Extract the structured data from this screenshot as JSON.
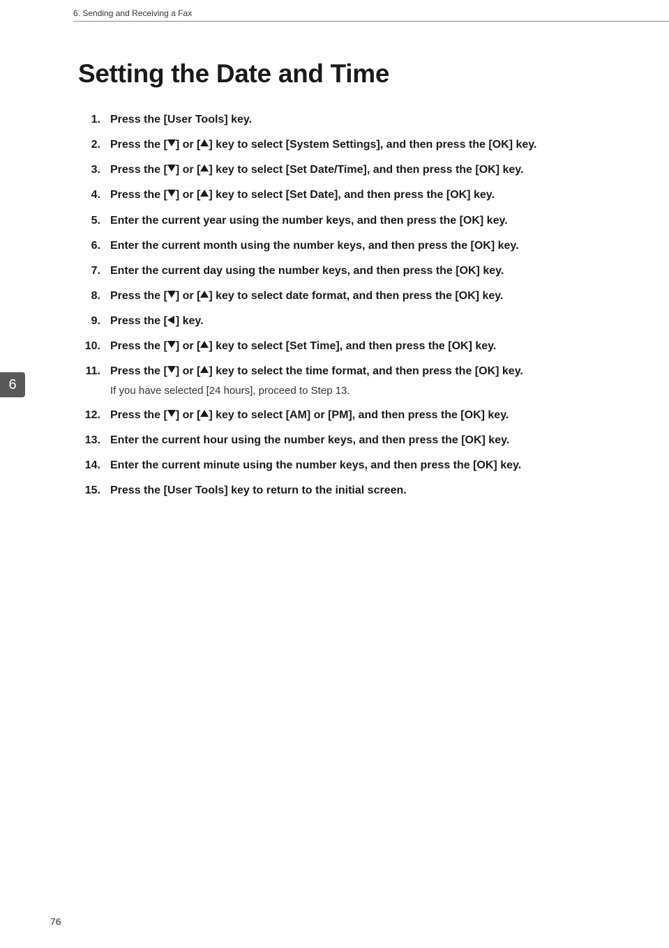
{
  "header": {
    "chapter": "6. Sending and Receiving a Fax"
  },
  "title": "Setting the Date and Time",
  "side_tab": "6",
  "page_number": "76",
  "steps": [
    {
      "num": "1.",
      "segments": [
        {
          "t": "text",
          "v": "Press the [User Tools] key."
        }
      ]
    },
    {
      "num": "2.",
      "segments": [
        {
          "t": "text",
          "v": "Press the ["
        },
        {
          "t": "arrow",
          "v": "down"
        },
        {
          "t": "text",
          "v": "] or ["
        },
        {
          "t": "arrow",
          "v": "up"
        },
        {
          "t": "text",
          "v": "] key to select [System Settings], and then press the [OK] key."
        }
      ]
    },
    {
      "num": "3.",
      "segments": [
        {
          "t": "text",
          "v": "Press the ["
        },
        {
          "t": "arrow",
          "v": "down"
        },
        {
          "t": "text",
          "v": "] or ["
        },
        {
          "t": "arrow",
          "v": "up"
        },
        {
          "t": "text",
          "v": "] key to select [Set Date/Time], and then press the [OK] key."
        }
      ]
    },
    {
      "num": "4.",
      "segments": [
        {
          "t": "text",
          "v": "Press the ["
        },
        {
          "t": "arrow",
          "v": "down"
        },
        {
          "t": "text",
          "v": "] or ["
        },
        {
          "t": "arrow",
          "v": "up"
        },
        {
          "t": "text",
          "v": "] key to select [Set Date], and then press the [OK] key."
        }
      ]
    },
    {
      "num": "5.",
      "segments": [
        {
          "t": "text",
          "v": "Enter the current year using the number keys, and then press the [OK] key."
        }
      ]
    },
    {
      "num": "6.",
      "segments": [
        {
          "t": "text",
          "v": "Enter the current month using the number keys, and then press the [OK] key."
        }
      ]
    },
    {
      "num": "7.",
      "segments": [
        {
          "t": "text",
          "v": "Enter the current day using the number keys, and then press the [OK] key."
        }
      ]
    },
    {
      "num": "8.",
      "segments": [
        {
          "t": "text",
          "v": "Press the ["
        },
        {
          "t": "arrow",
          "v": "down"
        },
        {
          "t": "text",
          "v": "] or ["
        },
        {
          "t": "arrow",
          "v": "up"
        },
        {
          "t": "text",
          "v": "] key to select date format, and then press the [OK] key."
        }
      ]
    },
    {
      "num": "9.",
      "segments": [
        {
          "t": "text",
          "v": "Press the ["
        },
        {
          "t": "arrow",
          "v": "left"
        },
        {
          "t": "text",
          "v": "] key."
        }
      ]
    },
    {
      "num": "10.",
      "segments": [
        {
          "t": "text",
          "v": "Press the ["
        },
        {
          "t": "arrow",
          "v": "down"
        },
        {
          "t": "text",
          "v": "] or ["
        },
        {
          "t": "arrow",
          "v": "up"
        },
        {
          "t": "text",
          "v": "] key to select [Set Time], and then press the [OK] key."
        }
      ]
    },
    {
      "num": "11.",
      "segments": [
        {
          "t": "text",
          "v": "Press the ["
        },
        {
          "t": "arrow",
          "v": "down"
        },
        {
          "t": "text",
          "v": "] or ["
        },
        {
          "t": "arrow",
          "v": "up"
        },
        {
          "t": "text",
          "v": "] key to select the time format, and then press the [OK] key."
        }
      ],
      "note": "If you have selected [24 hours], proceed to Step 13."
    },
    {
      "num": "12.",
      "segments": [
        {
          "t": "text",
          "v": "Press the ["
        },
        {
          "t": "arrow",
          "v": "down"
        },
        {
          "t": "text",
          "v": "] or ["
        },
        {
          "t": "arrow",
          "v": "up"
        },
        {
          "t": "text",
          "v": "] key to select [AM] or [PM], and then press the [OK] key."
        }
      ]
    },
    {
      "num": "13.",
      "segments": [
        {
          "t": "text",
          "v": "Enter the current hour using the number keys, and then press the [OK] key."
        }
      ]
    },
    {
      "num": "14.",
      "segments": [
        {
          "t": "text",
          "v": "Enter the current minute using the number keys, and then press the [OK] key."
        }
      ]
    },
    {
      "num": "15.",
      "segments": [
        {
          "t": "text",
          "v": "Press the [User Tools] key to return to the initial screen."
        }
      ]
    }
  ]
}
